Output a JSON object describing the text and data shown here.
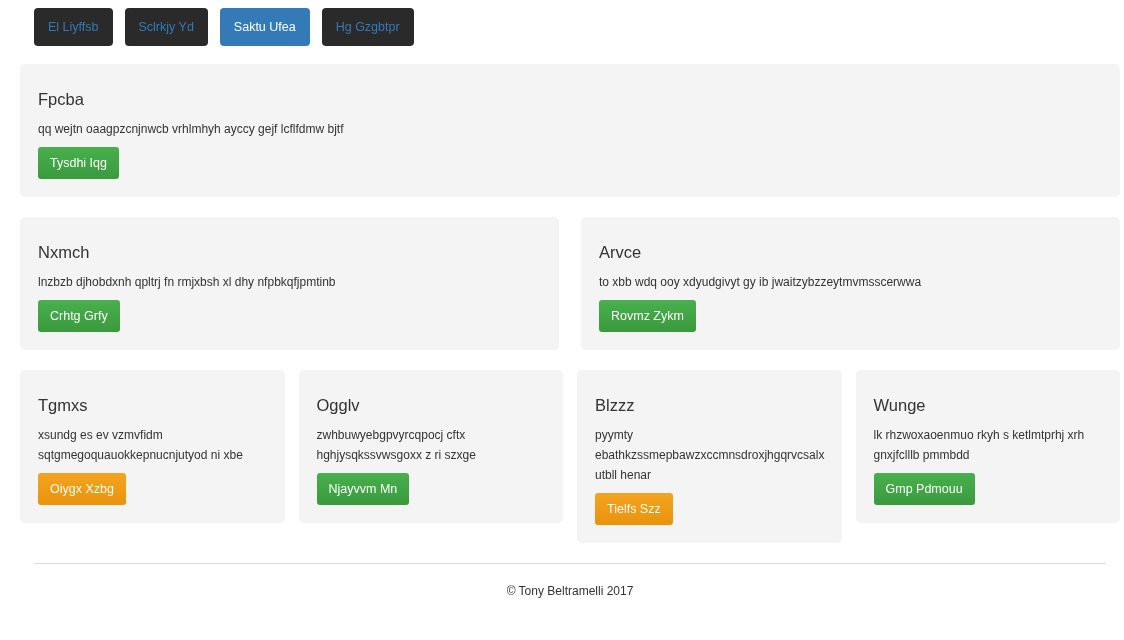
{
  "nav": [
    {
      "label": "El Liyffsb",
      "selected": false
    },
    {
      "label": "Sclrkjy Yd",
      "selected": false
    },
    {
      "label": "Saktu Ufea",
      "selected": true
    },
    {
      "label": "Hg Gzgbtpr",
      "selected": false
    }
  ],
  "rows": [
    {
      "cards": [
        {
          "title": "Fpcba",
          "text": "qq wejtn oaagpzcnjnwcb vrhlmhyh ayccy gejf lcflfdmw bjtf",
          "button": {
            "label": "Tysdhi Iqg",
            "kind": "success"
          }
        }
      ]
    },
    {
      "cards": [
        {
          "title": "Nxmch",
          "text": "lnzbzb djhobdxnh qpltrj fn rmjxbsh xl dhy nfpbkqfjpmtinb",
          "button": {
            "label": "Crhtg Grfy",
            "kind": "success"
          }
        },
        {
          "title": "Arvce",
          "text": "to xbb wdq ooy xdyudgivyt gy ib jwaitzybzzeytmvmsscerwwa",
          "button": {
            "label": "Rovmz Zykm",
            "kind": "success"
          }
        }
      ]
    },
    {
      "cards": [
        {
          "title": "Tgmxs",
          "text": "xsundg es ev vzmvfidm sqtgmegoquauokkepnucnjutyod ni xbe",
          "button": {
            "label": "Oiygx Xzbg",
            "kind": "warning"
          }
        },
        {
          "title": "Ogglv",
          "text": "zwhbuwyebgpvyrcqpocj cftx hghjysqkssvwsgoxx z ri szxge",
          "button": {
            "label": "Njayvvm Mn",
            "kind": "success"
          }
        },
        {
          "title": "Blzzz",
          "text": "pyymty ebathkzssmepbawzxccmnsdroxjhgqrvcsalx utbll henar",
          "button": {
            "label": "Tielfs Szz",
            "kind": "warning"
          }
        },
        {
          "title": "Wunge",
          "text": "lk rhzwoxaoenmuo rkyh s ketlmtprhj xrh gnxjfclllb pmmbdd",
          "button": {
            "label": "Gmp Pdmouu",
            "kind": "success"
          }
        }
      ]
    }
  ],
  "footer": "© Tony Beltramelli 2017"
}
